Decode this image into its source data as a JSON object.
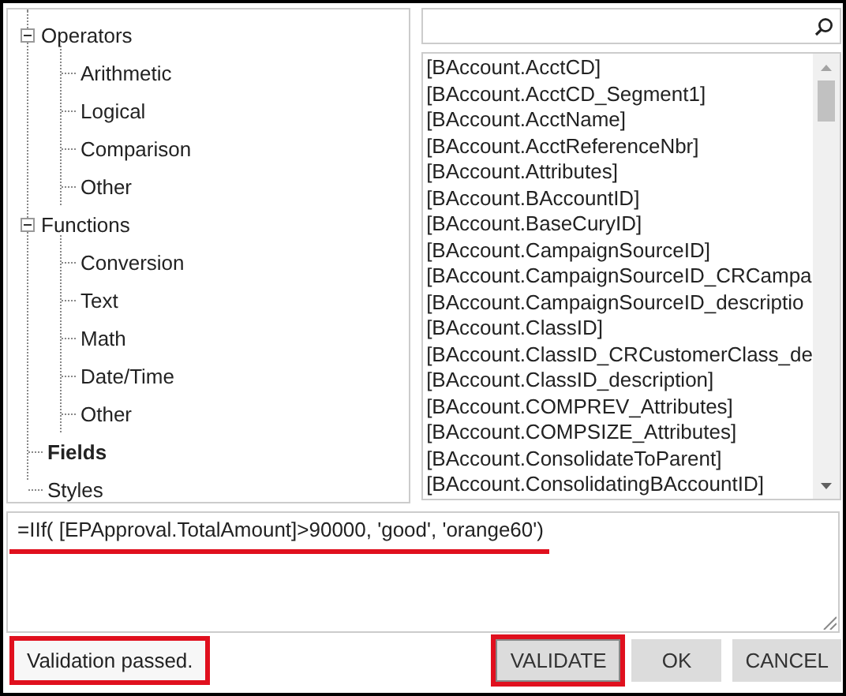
{
  "tree": [
    {
      "label": "Operators",
      "expanded": true,
      "selected": false,
      "children": [
        {
          "label": "Arithmetic",
          "selected": false
        },
        {
          "label": "Logical",
          "selected": false
        },
        {
          "label": "Comparison",
          "selected": false
        },
        {
          "label": "Other",
          "selected": false
        }
      ]
    },
    {
      "label": "Functions",
      "expanded": true,
      "selected": false,
      "children": [
        {
          "label": "Conversion",
          "selected": false
        },
        {
          "label": "Text",
          "selected": false
        },
        {
          "label": "Math",
          "selected": false
        },
        {
          "label": "Date/Time",
          "selected": false
        },
        {
          "label": "Other",
          "selected": false
        }
      ]
    },
    {
      "label": "Fields",
      "selected": true
    },
    {
      "label": "Styles",
      "selected": false
    }
  ],
  "fields_list": [
    "[BAccount.AcctCD]",
    "[BAccount.AcctCD_Segment1]",
    "[BAccount.AcctName]",
    "[BAccount.AcctReferenceNbr]",
    "[BAccount.Attributes]",
    "[BAccount.BAccountID]",
    "[BAccount.BaseCuryID]",
    "[BAccount.CampaignSourceID]",
    "[BAccount.CampaignSourceID_CRCampa",
    "[BAccount.CampaignSourceID_descriptio",
    "[BAccount.ClassID]",
    "[BAccount.ClassID_CRCustomerClass_de",
    "[BAccount.ClassID_description]",
    "[BAccount.COMPREV_Attributes]",
    "[BAccount.COMPSIZE_Attributes]",
    "[BAccount.ConsolidateToParent]",
    "[BAccount.ConsolidatingBAccountID]"
  ],
  "expression": {
    "value": "=IIf( [EPApproval.TotalAmount]>90000, 'good', 'orange60')",
    "highlighted": true
  },
  "status": {
    "text": "Validation passed.",
    "highlighted": true
  },
  "buttons": [
    {
      "label": "VALIDATE",
      "highlighted": true
    },
    {
      "label": "OK",
      "highlighted": false
    },
    {
      "label": "CANCEL",
      "highlighted": false
    }
  ]
}
